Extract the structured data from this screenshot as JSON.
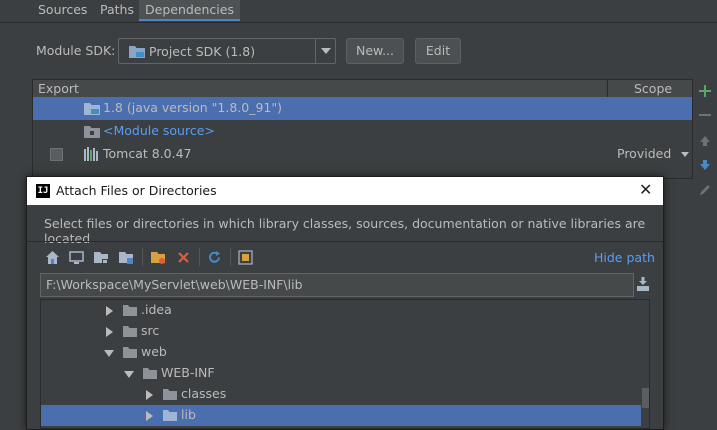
{
  "tabs": [
    "Sources",
    "Paths",
    "Dependencies"
  ],
  "active_tab": "Dependencies",
  "module_sdk": {
    "label": "Module SDK:",
    "value": "Project SDK (1.8)",
    "new_button": "New...",
    "edit_button": "Edit"
  },
  "dependencies": {
    "headers": {
      "export": "Export",
      "scope": "Scope"
    },
    "rows": [
      {
        "label": "1.8 (java version \"1.8.0_91\")",
        "scope": "",
        "selected": true,
        "icon": "jdk-folder-icon"
      },
      {
        "label": "<Module source>",
        "scope": "",
        "selected": false,
        "icon": "module-source-folder-icon"
      },
      {
        "label": "Tomcat 8.0.47",
        "scope": "Provided",
        "selected": false,
        "icon": "library-icon"
      }
    ]
  },
  "side_toolbar": [
    "add-icon",
    "remove-icon",
    "move-up-icon",
    "move-down-icon",
    "edit-icon"
  ],
  "dialog": {
    "title": "Attach Files or Directories",
    "description": "Select files or directories in which library classes, sources, documentation or native libraries are located",
    "hide_path": "Hide path",
    "path": "F:\\Workspace\\MyServlet\\web\\WEB-INF\\lib",
    "toolbar": [
      "home-icon",
      "desktop-icon",
      "project-folder-icon",
      "module-folder-icon",
      "new-folder-icon",
      "delete-icon",
      "refresh-icon",
      "show-hidden-icon"
    ],
    "tree": [
      {
        "label": ".idea",
        "depth": 0,
        "expanded": false,
        "selected": false
      },
      {
        "label": "src",
        "depth": 0,
        "expanded": false,
        "selected": false
      },
      {
        "label": "web",
        "depth": 0,
        "expanded": true,
        "selected": false
      },
      {
        "label": "WEB-INF",
        "depth": 1,
        "expanded": true,
        "selected": false
      },
      {
        "label": "classes",
        "depth": 2,
        "expanded": false,
        "selected": false
      },
      {
        "label": "lib",
        "depth": 2,
        "expanded": false,
        "selected": true
      }
    ]
  },
  "colors": {
    "background": "#3c3f41",
    "selection": "#4b6eaf",
    "link": "#589df6",
    "accent_green": "#59a869"
  }
}
